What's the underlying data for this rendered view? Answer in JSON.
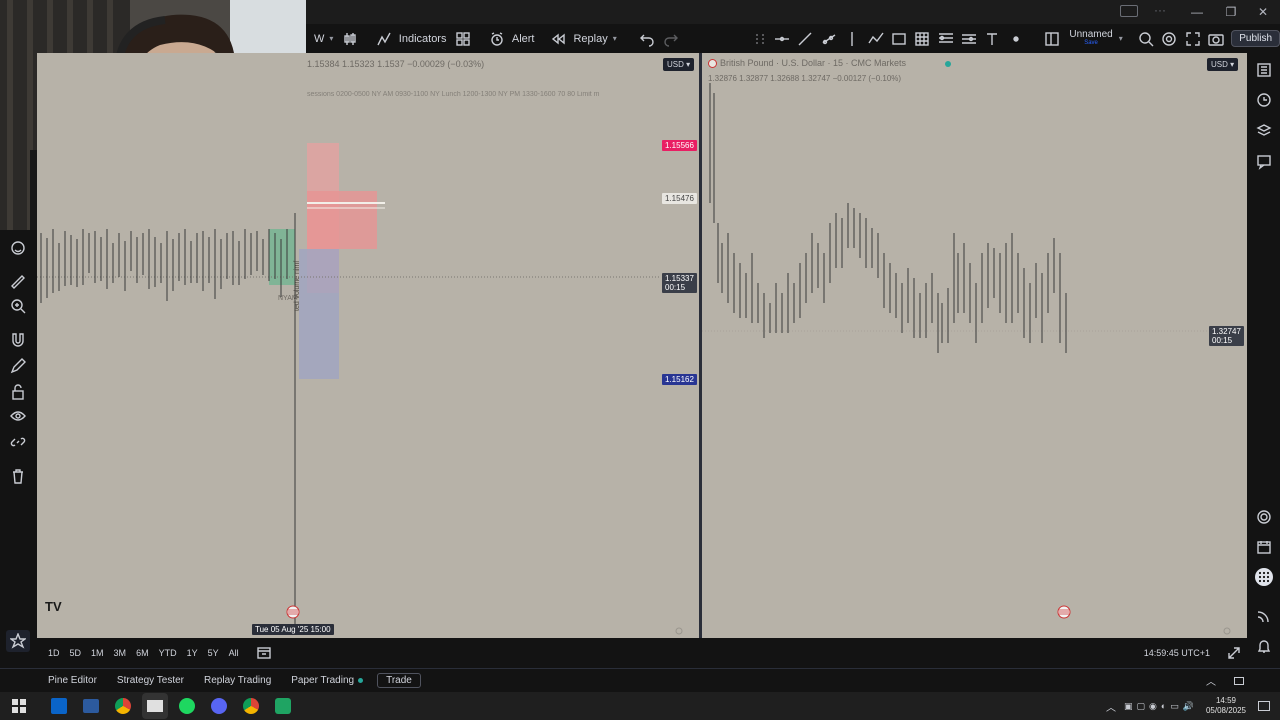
{
  "toolbar": {
    "interval": "W",
    "indicators_label": "Indicators",
    "alert_label": "Alert",
    "replay_label": "Replay",
    "layout_name": "Unnamed",
    "layout_sub": "Save",
    "publish_label": "Publish"
  },
  "left_chart": {
    "ohlc": "1.15384  1.15323  1.1537  −0.00029 (−0.03%)",
    "sessions_text": "sessions 0200-0500 NY AM 0930-1100 NY Lunch 1200-1300 NY PM 1330-1600 70 80 Limit m",
    "currency": "USD",
    "price_red": "1.15566",
    "price_white": "1.15476",
    "price_current": "1.15337",
    "countdown": "00:15",
    "price_blue": "1.15162",
    "crosshair_date": "Tue 05 Aug '25   15:00",
    "session_label": "NYAM",
    "vertical_text": "ted Volume nimf"
  },
  "right_chart": {
    "symbol": "British Pound · U.S. Dollar · 15 · CMC Markets",
    "ohlc": "1.32876  1.32877  1.32688  1.32747  −0.00127 (−0.10%)",
    "currency": "USD",
    "price_current": "1.32747",
    "countdown": "00:15"
  },
  "range_bar": {
    "ranges": [
      "1D",
      "5D",
      "1M",
      "3M",
      "6M",
      "YTD",
      "1Y",
      "5Y",
      "All"
    ],
    "clock": "14:59:45 UTC+1"
  },
  "bottom_tabs": {
    "pine_editor": "Pine Editor",
    "strategy_tester": "Strategy Tester",
    "replay_trading": "Replay Trading",
    "paper_trading": "Paper Trading",
    "trade": "Trade"
  },
  "taskbar": {
    "time": "14:59",
    "date": "05/08/2025"
  },
  "colors": {
    "chart_bg": "#b7b2a8",
    "price_red": "#e91e63",
    "price_blue": "#283593",
    "bull_box": "#5cb58a",
    "bear_box": "#e7a0a0",
    "blue_box": "#9fa4c2"
  }
}
